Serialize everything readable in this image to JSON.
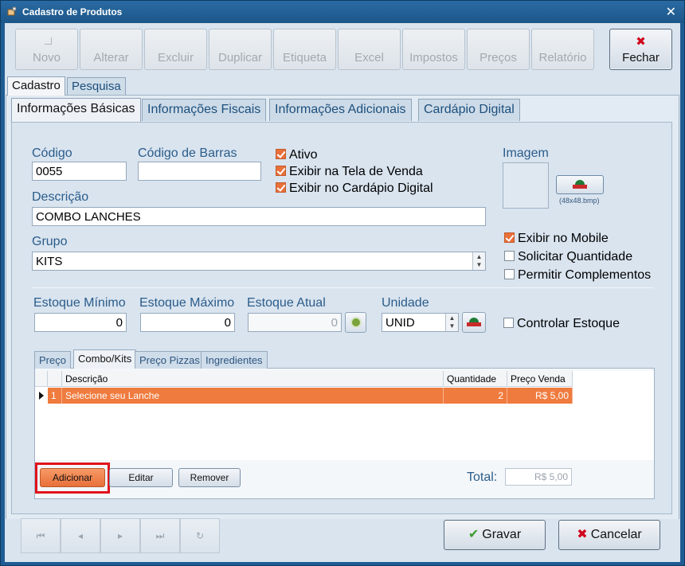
{
  "window": {
    "title": "Cadastro de Produtos"
  },
  "toolbar": {
    "buttons": [
      {
        "label": "Novo",
        "enabled": false
      },
      {
        "label": "Alterar",
        "enabled": false
      },
      {
        "label": "Excluir",
        "enabled": false
      },
      {
        "label": "Duplicar",
        "enabled": false
      },
      {
        "label": "Etiqueta",
        "enabled": false
      },
      {
        "label": "Excel",
        "enabled": false
      },
      {
        "label": "Impostos",
        "enabled": false
      },
      {
        "label": "Preços",
        "enabled": false
      },
      {
        "label": "Relatório",
        "enabled": false
      }
    ],
    "close_label": "Fechar"
  },
  "main_tabs": [
    "Cadastro",
    "Pesquisa"
  ],
  "sub_tabs": [
    "Informações Básicas",
    "Informações Fiscais",
    "Informações Adicionais",
    "Cardápio Digital"
  ],
  "form": {
    "codigo_label": "Código",
    "codigo_value": "0055",
    "barras_label": "Código de Barras",
    "barras_value": "",
    "descricao_label": "Descrição",
    "descricao_value": "COMBO LANCHES",
    "grupo_label": "Grupo",
    "grupo_value": "KITS",
    "ativo": "Ativo",
    "exibir_venda": "Exibir na Tela de Venda",
    "exibir_cardapio": "Exibir no Cardápio Digital",
    "imagem_label": "Imagem",
    "imagem_hint": "(48x48.bmp)",
    "exibir_mobile": "Exibir no Mobile",
    "solicitar_qtd": "Solicitar Quantidade",
    "permitir_comp": "Permitir Complementos",
    "est_min_label": "Estoque Mínimo",
    "est_min_value": "0",
    "est_max_label": "Estoque Máximo",
    "est_max_value": "0",
    "est_atual_label": "Estoque Atual",
    "est_atual_value": "0",
    "unidade_label": "Unidade",
    "unidade_value": "UNID",
    "controlar_estoque": "Controlar Estoque"
  },
  "inner_tabs": [
    "Preço",
    "Combo/Kits",
    "Preço Pizzas",
    "Ingredientes"
  ],
  "grid": {
    "headers": [
      "Descrição",
      "Quantidade",
      "Preço Venda"
    ],
    "rows": [
      {
        "n": "1",
        "descricao": "Selecione seu Lanche",
        "quantidade": "2",
        "preco": "R$ 5,00"
      }
    ]
  },
  "actions": {
    "adicionar": "Adicionar",
    "editar": "Editar",
    "remover": "Remover"
  },
  "total": {
    "label": "Total:",
    "value": "R$ 5,00"
  },
  "footer": {
    "gravar": "Gravar",
    "cancelar": "Cancelar"
  },
  "nav_icons": [
    "first-icon",
    "prev-icon",
    "next-icon",
    "last-icon",
    "refresh-icon"
  ],
  "colors": {
    "accent_orange": "#e8703a",
    "highlight_red": "#e0121b",
    "title_blue": "#1f5c92"
  }
}
